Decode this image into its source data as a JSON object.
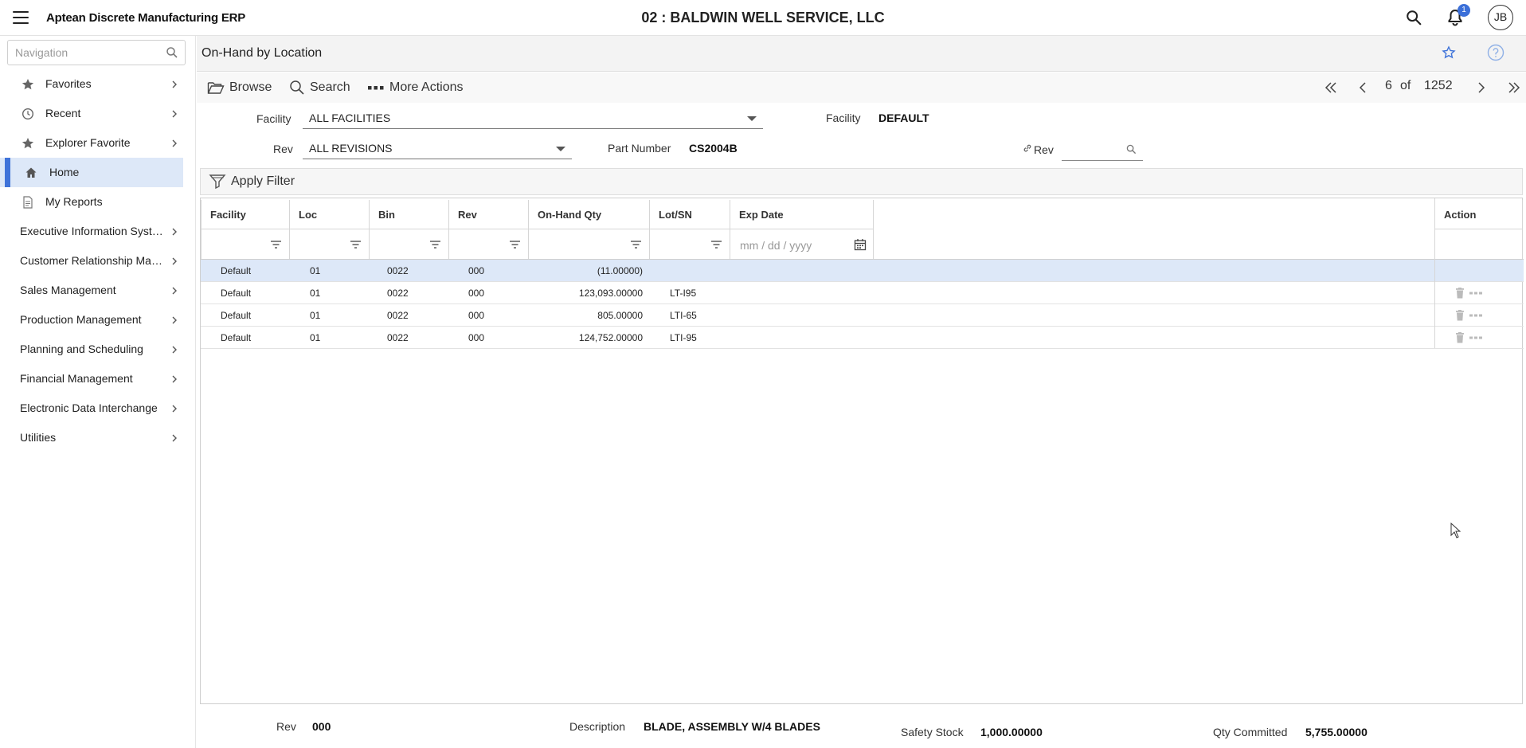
{
  "app": {
    "title": "Aptean Discrete Manufacturing ERP",
    "company": "02 : BALDWIN WELL SERVICE, LLC",
    "notifications_count": "1",
    "user_initials": "JB"
  },
  "sidebar": {
    "search_placeholder": "Navigation",
    "items": [
      {
        "label": "Favorites",
        "icon": "star-icon"
      },
      {
        "label": "Recent",
        "icon": "clock-icon"
      },
      {
        "label": "Explorer Favorite",
        "icon": "star-icon"
      },
      {
        "label": "Home",
        "icon": "home-icon"
      },
      {
        "label": "My Reports",
        "icon": "report-icon"
      }
    ],
    "sections": [
      "Executive Information System",
      "Customer Relationship Management",
      "Sales Management",
      "Production Management",
      "Planning and Scheduling",
      "Financial Management",
      "Electronic Data Interchange",
      "Utilities"
    ]
  },
  "page": {
    "title": "On-Hand by Location"
  },
  "toolbar": {
    "browse": "Browse",
    "search": "Search",
    "more_actions": "More Actions",
    "pager": {
      "current": "6",
      "of": "of",
      "total": "1252"
    }
  },
  "form": {
    "facility_label": "Facility",
    "facility_select": "ALL FACILITIES",
    "rev_label": "Rev",
    "rev_select": "ALL REVISIONS",
    "facility2_label": "Facility",
    "facility2_value": "DEFAULT",
    "part_number_label": "Part Number",
    "part_number_value": "CS2004B",
    "rev2_label": "Rev",
    "rev2_value": ""
  },
  "filter": {
    "apply_label": "Apply Filter"
  },
  "grid": {
    "columns": [
      "Facility",
      "Loc",
      "Bin",
      "Rev",
      "On-Hand Qty",
      "Lot/SN",
      "Exp Date"
    ],
    "action_header": "Action",
    "date_placeholder": "mm / dd / yyyy",
    "rows": [
      {
        "facility": "Default",
        "loc": "01",
        "bin": "0022",
        "rev": "000",
        "qty": "(11.00000)",
        "lot": ""
      },
      {
        "facility": "Default",
        "loc": "01",
        "bin": "0022",
        "rev": "000",
        "qty": "123,093.00000",
        "lot": "LT-I95"
      },
      {
        "facility": "Default",
        "loc": "01",
        "bin": "0022",
        "rev": "000",
        "qty": "805.00000",
        "lot": "LTI-65"
      },
      {
        "facility": "Default",
        "loc": "01",
        "bin": "0022",
        "rev": "000",
        "qty": "124,752.00000",
        "lot": "LTI-95"
      }
    ]
  },
  "footer": {
    "rev_label": "Rev",
    "rev_value": "000",
    "description_label": "Description",
    "description_value": "BLADE, ASSEMBLY W/4 BLADES",
    "safety_stock_label": "Safety Stock",
    "safety_stock_value": "1,000.00000",
    "qty_committed_label": "Qty Committed",
    "qty_committed_value": "5,755.00000"
  },
  "colors": {
    "accent": "#3f73d9",
    "selected_row": "#dde8f8"
  }
}
